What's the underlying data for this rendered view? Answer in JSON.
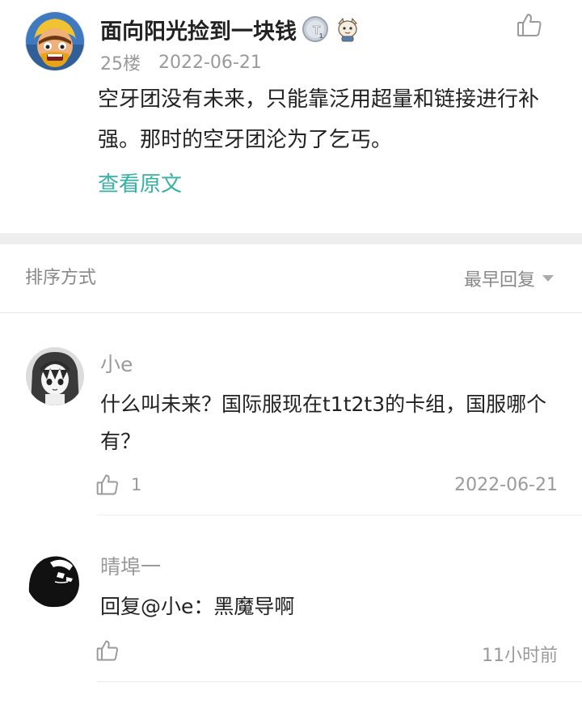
{
  "post": {
    "username": "面向阳光捡到一块钱",
    "floor": "25楼",
    "date": "2022-06-21",
    "content": "空牙团没有未来，只能靠泛用超量和链接进行补强。那时的空牙团沦为了乞丐。",
    "view_original": "查看原文",
    "avatar_icon": "clash-barbarian-avatar-icon",
    "level_badge_text": "T",
    "level_badge_sub": "1"
  },
  "sort": {
    "label": "排序方式",
    "selected": "最早回复"
  },
  "replies": [
    {
      "username": "小e",
      "content": "什么叫未来？国际服现在t1t2t3的卡组，国服哪个有？",
      "likes": "1",
      "time": "2022-06-21",
      "avatar_icon": "anime-girl-avatar-icon"
    },
    {
      "username": "晴埠一",
      "content": "回复@小e：黑魔导啊",
      "likes": "",
      "time": "11小时前",
      "avatar_icon": "dark-figure-avatar-icon"
    }
  ],
  "colors": {
    "accent": "#35b1a6",
    "meta": "#9a9a9a",
    "text": "#222222",
    "separator": "#eeeeee"
  }
}
